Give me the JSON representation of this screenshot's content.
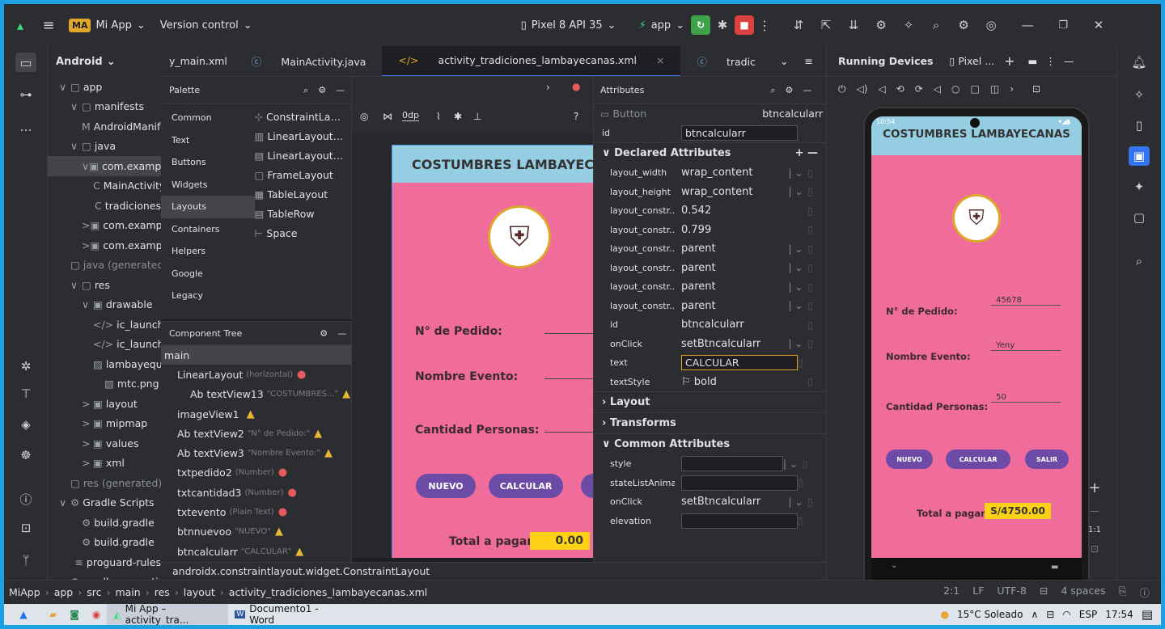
{
  "titlebar": {
    "project_badge": "MA",
    "project": "Mi App",
    "vcs": "Version control",
    "device": "Pixel 8 API 35",
    "run_config": "app"
  },
  "project": {
    "root": "Android",
    "items": [
      {
        "label": "app",
        "indent": 1,
        "icon": "▢",
        "arrow": "∨"
      },
      {
        "label": "manifests",
        "indent": 2,
        "icon": "▢",
        "arrow": "∨"
      },
      {
        "label": "AndroidManifest.xml",
        "indent": 3,
        "icon": "M",
        "arrow": ""
      },
      {
        "label": "java",
        "indent": 2,
        "icon": "▢",
        "arrow": "∨"
      },
      {
        "label": "com.example",
        "indent": 3,
        "icon": "▣",
        "arrow": "∨",
        "selected": true
      },
      {
        "label": "MainActivity",
        "indent": 4,
        "icon": "C",
        "arrow": ""
      },
      {
        "label": "tradiciones",
        "indent": 4,
        "icon": "C",
        "arrow": ""
      },
      {
        "label": "com.example",
        "indent": 3,
        "icon": "▣",
        "arrow": ">"
      },
      {
        "label": "com.example",
        "indent": 3,
        "icon": "▣",
        "arrow": ">"
      },
      {
        "label": "java (generated)",
        "indent": 2,
        "icon": "▢",
        "arrow": ""
      },
      {
        "label": "res",
        "indent": 2,
        "icon": "▢",
        "arrow": "∨"
      },
      {
        "label": "drawable",
        "indent": 3,
        "icon": "▣",
        "arrow": "∨"
      },
      {
        "label": "ic_launcher",
        "indent": 4,
        "icon": "</>",
        "arrow": ""
      },
      {
        "label": "ic_launcher",
        "indent": 4,
        "icon": "</>",
        "arrow": ""
      },
      {
        "label": "lambayeque",
        "indent": 4,
        "icon": "▨",
        "arrow": ""
      },
      {
        "label": "mtc.png",
        "indent": 4,
        "icon": "▨",
        "arrow": ""
      },
      {
        "label": "layout",
        "indent": 3,
        "icon": "▣",
        "arrow": ">"
      },
      {
        "label": "mipmap",
        "indent": 3,
        "icon": "▣",
        "arrow": ">"
      },
      {
        "label": "values",
        "indent": 3,
        "icon": "▣",
        "arrow": ">"
      },
      {
        "label": "xml",
        "indent": 3,
        "icon": "▣",
        "arrow": ">"
      },
      {
        "label": "res (generated)",
        "indent": 2,
        "icon": "▢",
        "arrow": ""
      },
      {
        "label": "Gradle Scripts",
        "indent": 1,
        "icon": "⚙",
        "arrow": "∨"
      },
      {
        "label": "build.gradle",
        "indent": 2,
        "icon": "⚙",
        "arrow": ""
      },
      {
        "label": "build.gradle",
        "indent": 2,
        "icon": "⚙",
        "arrow": ""
      },
      {
        "label": "proguard-rules",
        "indent": 2,
        "icon": "≡",
        "arrow": ""
      },
      {
        "label": "gradle.properties",
        "indent": 2,
        "icon": "⚙",
        "arrow": ""
      }
    ]
  },
  "tabs": {
    "t1": "y_main.xml",
    "t2": "MainActivity.java",
    "t3": "activity_tradiciones_lambayecanas.xml",
    "t4": "tradic"
  },
  "palette": {
    "title": "Palette",
    "categories": [
      "Common",
      "Text",
      "Buttons",
      "Widgets",
      "Layouts",
      "Containers",
      "Helpers",
      "Google",
      "Legacy"
    ],
    "selected": "Layouts",
    "items": [
      {
        "icon": "⊹",
        "label": "ConstraintLayout"
      },
      {
        "icon": "▥",
        "label": "LinearLayout (horizontal)"
      },
      {
        "icon": "▤",
        "label": "LinearLayout (vertical)"
      },
      {
        "icon": "▢",
        "label": "FrameLayout"
      },
      {
        "icon": "▦",
        "label": "TableLayout"
      },
      {
        "icon": "▤",
        "label": "TableRow"
      },
      {
        "icon": "⊢",
        "label": "Space"
      }
    ]
  },
  "component_tree": {
    "title": "Component Tree",
    "rows": [
      {
        "label": "main",
        "hint": "",
        "indent": 0,
        "status": ""
      },
      {
        "label": "LinearLayout",
        "hint": "(horizontal)",
        "indent": 1,
        "status": "err"
      },
      {
        "label": "Ab textView13",
        "hint": "\"COSTUMBRES...\"",
        "indent": 2,
        "status": "warn"
      },
      {
        "label": "imageView1",
        "hint": "",
        "indent": 1,
        "status": "warn"
      },
      {
        "label": "Ab textView2",
        "hint": "\"N° de Pedido:\"",
        "indent": 1,
        "status": "warn"
      },
      {
        "label": "Ab textView3",
        "hint": "\"Nombre Evento:\"",
        "indent": 1,
        "status": "warn"
      },
      {
        "label": "txtpedido2",
        "hint": "(Number)",
        "indent": 1,
        "status": "err"
      },
      {
        "label": "txtcantidad3",
        "hint": "(Number)",
        "indent": 1,
        "status": "err"
      },
      {
        "label": "txtevento",
        "hint": "(Plain Text)",
        "indent": 1,
        "status": "err"
      },
      {
        "label": "btnnuevoo",
        "hint": "\"NUEVO\"",
        "indent": 1,
        "status": "warn"
      },
      {
        "label": "btncalcularr",
        "hint": "\"CALCULAR\"",
        "indent": 1,
        "status": "warn"
      }
    ]
  },
  "design": {
    "dp": "0dp",
    "title": "COSTUMBRES LAMBAYECANAS",
    "lbl_pedido": "N° de Pedido:",
    "lbl_evento": "Nombre Evento:",
    "lbl_cantidad": "Cantidad Personas:",
    "btn_nuevo": "NUEVO",
    "btn_calcular": "CALCULAR",
    "lbl_total": "Total a pagar:",
    "total": "0.00"
  },
  "attributes": {
    "title": "Attributes",
    "widget": "Button",
    "widget_id": "btncalcularr",
    "id_label": "id",
    "id_value": "btncalcularr",
    "declared": "Declared Attributes",
    "declared_rows": [
      {
        "name": "layout_width",
        "value": "wrap_content",
        "dd": true
      },
      {
        "name": "layout_height",
        "value": "wrap_content",
        "dd": true
      },
      {
        "name": "layout_constr...",
        "value": "0.542",
        "dd": false
      },
      {
        "name": "layout_constr...",
        "value": "0.799",
        "dd": false
      },
      {
        "name": "layout_constr...",
        "value": "parent",
        "dd": true
      },
      {
        "name": "layout_constr...",
        "value": "parent",
        "dd": true
      },
      {
        "name": "layout_constr...",
        "value": "parent",
        "dd": true
      },
      {
        "name": "layout_constr...",
        "value": "parent",
        "dd": true
      },
      {
        "name": "id",
        "value": "btncalcularr",
        "dd": false
      },
      {
        "name": "onClick",
        "value": "setBtncalcularr",
        "dd": true
      },
      {
        "name": "text",
        "value": "CALCULAR",
        "dd": false,
        "box": true
      },
      {
        "name": "textStyle",
        "value": "bold",
        "dd": false,
        "flag": true
      }
    ],
    "sec_layout": "Layout",
    "sec_transforms": "Transforms",
    "sec_common": "Common Attributes",
    "common_rows": [
      {
        "name": "style",
        "value": "",
        "dd": true
      },
      {
        "name": "stateListAnimator",
        "value": "",
        "dd": false
      },
      {
        "name": "onClick",
        "value": "setBtncalcularr",
        "dd": true
      },
      {
        "name": "elevation",
        "value": "",
        "dd": false
      }
    ]
  },
  "status_class": "androidx.constraintlayout.widget.ConstraintLayout",
  "running": {
    "title": "Running Devices",
    "device_tab": "Pixel ...",
    "status_time": "10:54",
    "title_app": "COSTUMBRES LAMBAYECANAS",
    "lbl_pedido": "N° de Pedido:",
    "val_pedido": "45678",
    "lbl_evento": "Nombre Evento:",
    "val_evento": "Yeny",
    "lbl_cantidad": "Cantidad Personas:",
    "val_cantidad": "50",
    "btn_nuevo": "NUEVO",
    "btn_calcular": "CALCULAR",
    "btn_salir": "SALIR",
    "lbl_total": "Total a pagar:",
    "total": "S/4750.00",
    "zoom": "1:1"
  },
  "breadcrumb": {
    "items": [
      "MiApp",
      "app",
      "src",
      "main",
      "res",
      "layout",
      "activity_tradiciones_lambayecanas.xml"
    ],
    "pos": "2:1",
    "lf": "LF",
    "enc": "UTF-8",
    "indent": "4 spaces"
  },
  "taskbar": {
    "app1": "Mi App – activity_tra...",
    "app2": "Documento1 - Word",
    "weather": "15°C Soleado",
    "lang": "ESP",
    "time": "17:54"
  }
}
